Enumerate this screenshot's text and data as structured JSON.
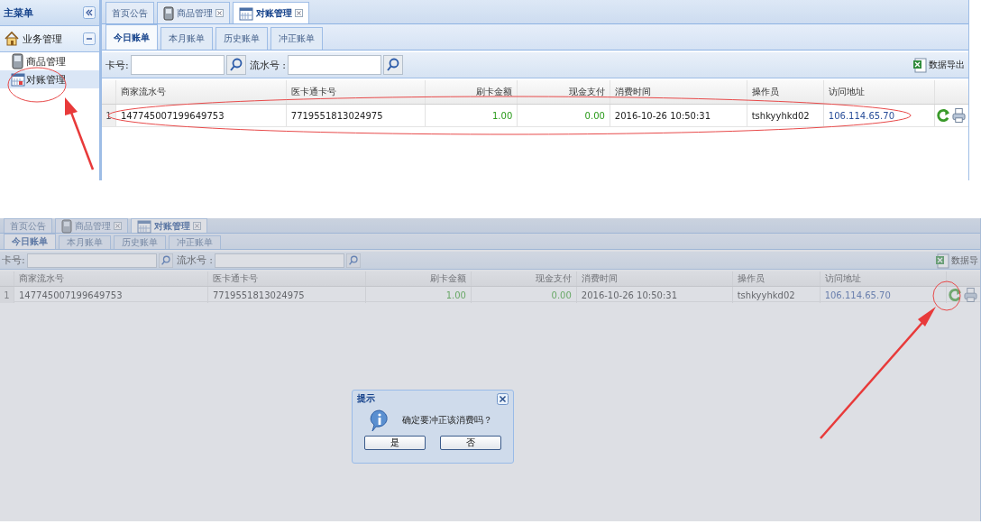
{
  "screens": [
    {
      "masked": false,
      "sidebar": {
        "title": "主菜单",
        "group": {
          "label": "业务管理",
          "expanded": true,
          "items": [
            {
              "label": "商品管理",
              "selected": false
            },
            {
              "label": "对账管理",
              "selected": true
            }
          ]
        }
      },
      "tabs": [
        {
          "label": "首页公告",
          "selected": false,
          "closable": false
        },
        {
          "label": "商品管理",
          "selected": false,
          "closable": true
        },
        {
          "label": "对账管理",
          "selected": true,
          "closable": true
        }
      ],
      "subtabs": [
        {
          "label": "今日账单",
          "selected": true
        },
        {
          "label": "本月账单",
          "selected": false
        },
        {
          "label": "历史账单",
          "selected": false
        },
        {
          "label": "冲正账单",
          "selected": false
        }
      ],
      "filters": [
        {
          "label": "卡号:"
        },
        {
          "label": "流水号 :"
        }
      ],
      "export_label": "数据导出",
      "table": {
        "columns": [
          {
            "label": "商家流水号",
            "kind": "text"
          },
          {
            "label": "医卡通卡号",
            "kind": "text"
          },
          {
            "label": "刷卡金额",
            "kind": "amount"
          },
          {
            "label": "现金支付",
            "kind": "amount"
          },
          {
            "label": "消费时间",
            "kind": "text"
          },
          {
            "label": "操作员",
            "kind": "text"
          },
          {
            "label": "访问地址",
            "kind": "link"
          }
        ],
        "rows": [
          {
            "index": "1",
            "cells": [
              "147745007199649753",
              "7719551813024975",
              "1.00",
              "0.00",
              "2016-10-26 10:50:31",
              "tshkyyhkd02",
              "106.114.65.70"
            ]
          }
        ]
      }
    },
    {
      "masked": true,
      "tabs": [
        {
          "label": "首页公告",
          "selected": false,
          "closable": false
        },
        {
          "label": "商品管理",
          "selected": false,
          "closable": true
        },
        {
          "label": "对账管理",
          "selected": true,
          "closable": true
        }
      ],
      "subtabs": [
        {
          "label": "今日账单",
          "selected": true
        },
        {
          "label": "本月账单",
          "selected": false
        },
        {
          "label": "历史账单",
          "selected": false
        },
        {
          "label": "冲正账单",
          "selected": false
        }
      ],
      "filters": [
        {
          "label": "卡号:"
        },
        {
          "label": "流水号 :"
        }
      ],
      "export_label": "数据导",
      "table": {
        "columns": [
          {
            "label": "商家流水号",
            "kind": "text"
          },
          {
            "label": "医卡通卡号",
            "kind": "text"
          },
          {
            "label": "刷卡金额",
            "kind": "amount"
          },
          {
            "label": "现金支付",
            "kind": "amount"
          },
          {
            "label": "消费时间",
            "kind": "text"
          },
          {
            "label": "操作员",
            "kind": "text"
          },
          {
            "label": "访问地址",
            "kind": "link"
          }
        ],
        "rows": [
          {
            "index": "1",
            "cells": [
              "147745007199649753",
              "7719551813024975",
              "1.00",
              "0.00",
              "2016-10-26 10:50:31",
              "tshkyyhkd02",
              "106.114.65.70"
            ]
          }
        ]
      }
    }
  ],
  "dialog": {
    "title": "提示",
    "message": "确定要冲正该消费吗？",
    "buttons": [
      "是",
      "否"
    ]
  }
}
